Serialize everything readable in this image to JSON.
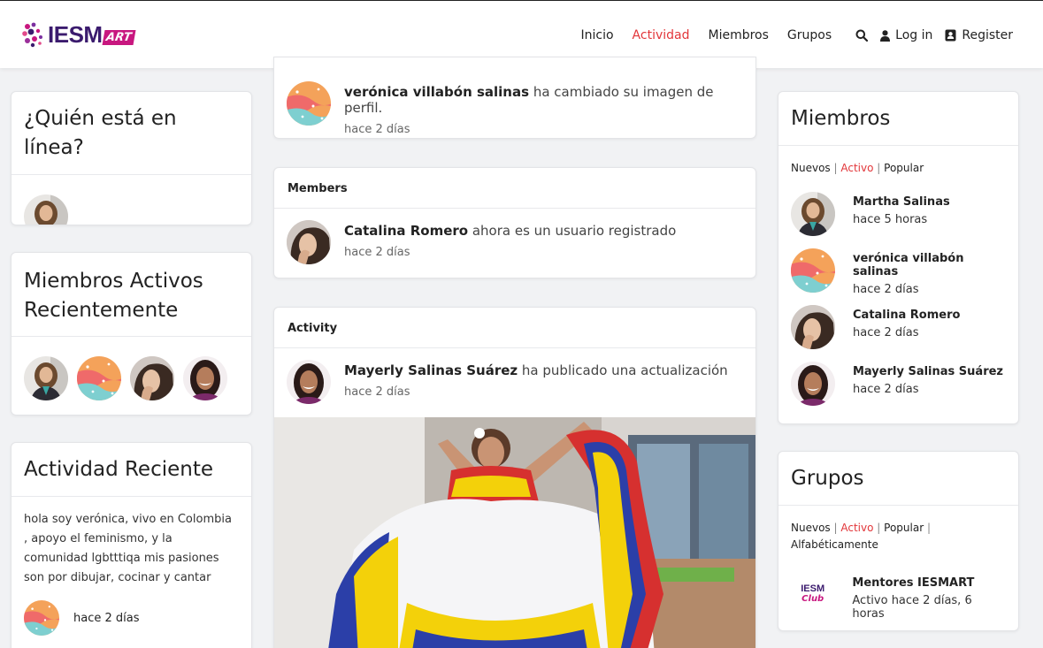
{
  "brand": {
    "name": "IESM",
    "tag": "ART"
  },
  "nav": {
    "items": [
      {
        "label": "Inicio",
        "active": false
      },
      {
        "label": "Actividad",
        "active": true
      },
      {
        "label": "Miembros",
        "active": false
      },
      {
        "label": "Grupos",
        "active": false
      }
    ],
    "login_label": "Log in",
    "register_label": "Register"
  },
  "online": {
    "title": "¿Quién está en línea?"
  },
  "recent_members": {
    "title": "Miembros Activos Recientemente"
  },
  "recent_activity": {
    "title": "Actividad Reciente",
    "text": "hola soy verónica, vivo en Colombia , apoyo el feminismo, y la comunidad lgbtttiqa mis pasiones son por dibujar, cocinar y cantar",
    "time": "hace 2 días"
  },
  "feed": {
    "top_item": {
      "name": "verónica villabón salinas",
      "action": " ha cambiado su imagen de perfil.",
      "time": "hace 2 días"
    },
    "members_card": {
      "title": "Members",
      "name": "Catalina Romero",
      "action": " ahora es un usuario registrado",
      "time": "hace 2 días"
    },
    "activity_card": {
      "title": "Activity",
      "name": "Mayerly Salinas Suárez",
      "action": " ha publicado una actualización",
      "time": "hace 2 días"
    }
  },
  "members_widget": {
    "title": "Miembros",
    "filters": [
      "Nuevos",
      "Activo",
      "Popular"
    ],
    "selected": "Activo",
    "separator": "|",
    "list": [
      {
        "name": "Martha Salinas",
        "time": "hace 5 horas"
      },
      {
        "name": "verónica villabón salinas",
        "time": "hace 2 días"
      },
      {
        "name": "Catalina Romero",
        "time": "hace 2 días"
      },
      {
        "name": "Mayerly Salinas Suárez",
        "time": "hace 2 días"
      }
    ]
  },
  "groups_widget": {
    "title": "Grupos",
    "filters": [
      "Nuevos",
      "Activo",
      "Popular",
      "Alfabéticamente"
    ],
    "selected": "Activo",
    "separator": "|",
    "group": {
      "name": "Mentores IESMART",
      "time": "Activo hace 2 días, 6 horas",
      "logo_text": "IESM",
      "logo_sub": "Club"
    }
  },
  "colors": {
    "accent": "#e2363a",
    "brand_purple": "#3b1b6e",
    "brand_magenta": "#c8177f"
  }
}
